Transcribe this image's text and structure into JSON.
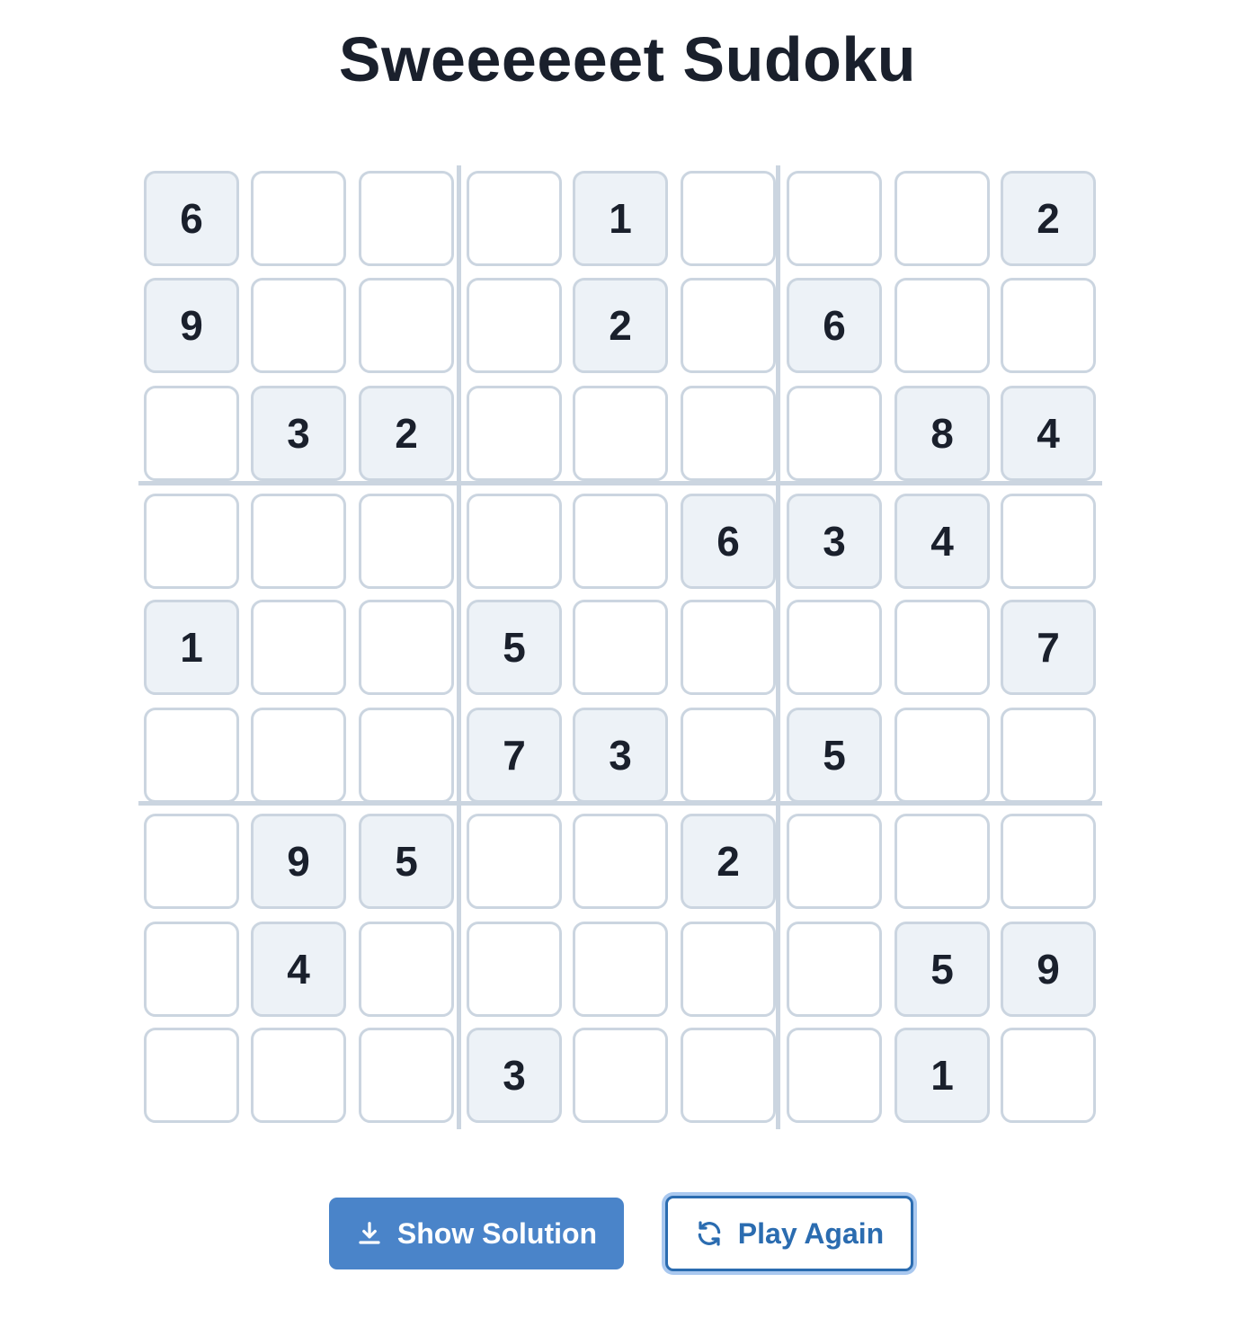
{
  "app": {
    "title": "Sweeeeeet Sudoku"
  },
  "grid": [
    [
      6,
      0,
      0,
      0,
      1,
      0,
      0,
      0,
      2
    ],
    [
      9,
      0,
      0,
      0,
      2,
      0,
      6,
      0,
      0
    ],
    [
      0,
      3,
      2,
      0,
      0,
      0,
      0,
      8,
      4
    ],
    [
      0,
      0,
      0,
      0,
      0,
      6,
      3,
      4,
      0
    ],
    [
      1,
      0,
      0,
      5,
      0,
      0,
      0,
      0,
      7
    ],
    [
      0,
      0,
      0,
      7,
      3,
      0,
      5,
      0,
      0
    ],
    [
      0,
      9,
      5,
      0,
      0,
      2,
      0,
      0,
      0
    ],
    [
      0,
      4,
      0,
      0,
      0,
      0,
      0,
      5,
      9
    ],
    [
      0,
      0,
      0,
      3,
      0,
      0,
      0,
      1,
      0
    ]
  ],
  "buttons": {
    "show_solution": {
      "label": "Show Solution",
      "icon": "download-icon"
    },
    "play_again": {
      "label": "Play Again",
      "icon": "refresh-icon"
    }
  },
  "colors": {
    "primary": "#4a84c9",
    "given_cell_bg": "#edf2f7",
    "cell_border": "#cbd5e0",
    "text": "#1a202c",
    "outline_button": "#2b6cb0"
  }
}
